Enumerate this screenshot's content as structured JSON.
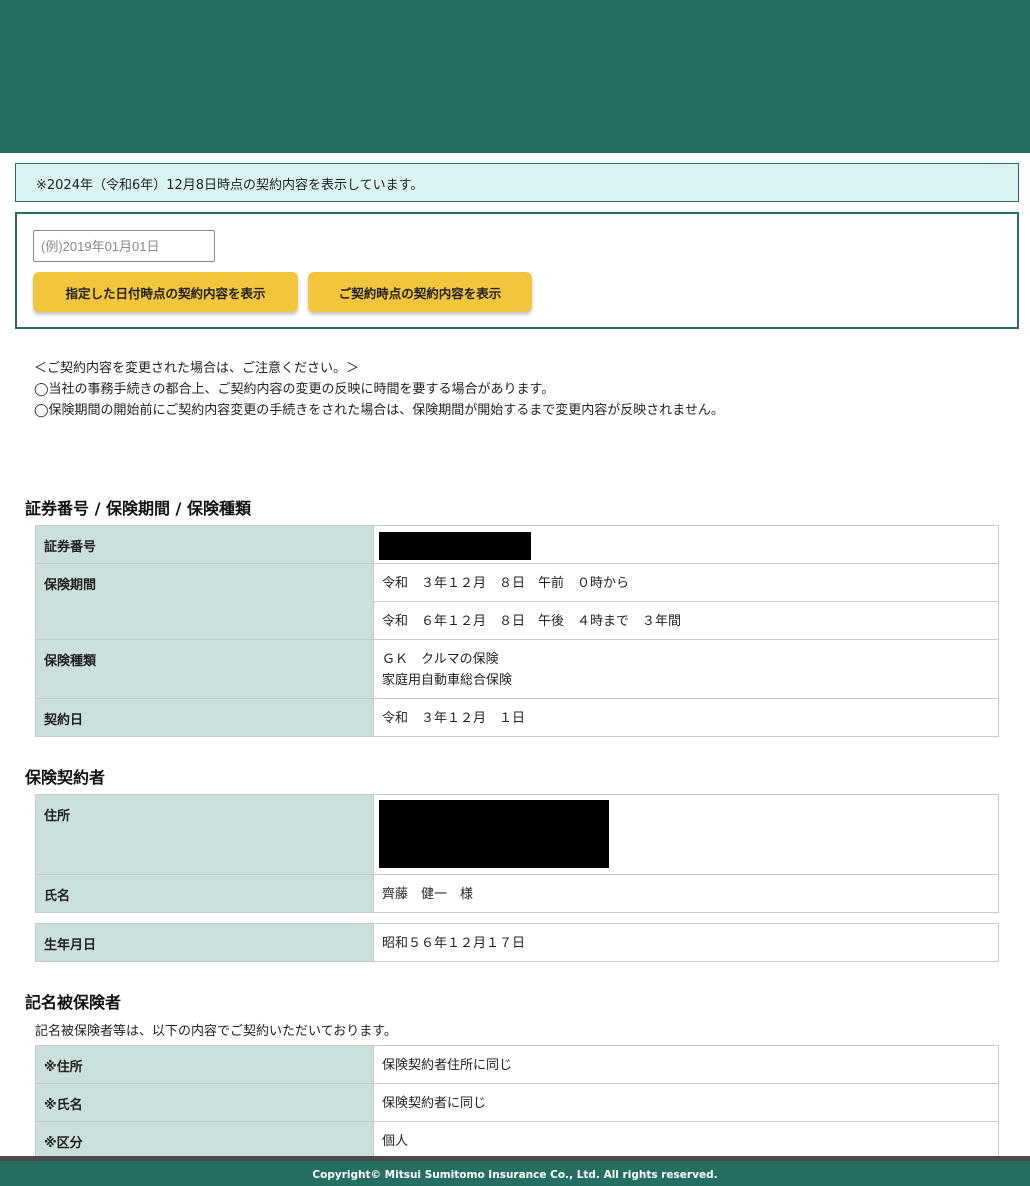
{
  "notice": {
    "text": "※2024年（令和6年）12月8日時点の契約内容を表示しています。"
  },
  "date_panel": {
    "input_placeholder": "(例)2019年01月01日",
    "btn_date_label": "指定した日付時点の契約内容を表示",
    "btn_contract_label": "ご契約時点の契約内容を表示"
  },
  "caution": {
    "heading": "＜ご契約内容を変更された場合は、ご注意ください。＞",
    "line1": "◯当社の事務手続きの都合上、ご契約内容の変更の反映に時間を要する場合があります。",
    "line2": "◯保険期間の開始前にご契約内容変更の手続きをされた場合は、保険期間が開始するまで変更内容が反映されません。"
  },
  "policy": {
    "title": "証券番号 / 保険期間 / 保険種類",
    "rows": [
      {
        "label": "証券番号"
      },
      {
        "label": "保険期間",
        "value1": "令和　３年１２月　８日　午前　０時から",
        "value2": "令和　６年１２月　８日　午後　４時まで　３年間"
      },
      {
        "label": "保険種類",
        "value1": "ＧＫ　クルマの保険",
        "value2": "家庭用自動車総合保険"
      },
      {
        "label": "契約日",
        "value": "令和　３年１２月　１日"
      }
    ]
  },
  "contractor": {
    "title": "保険契約者",
    "rows": [
      {
        "label": "住所"
      },
      {
        "label": "氏名",
        "value": "齊藤　健一　様"
      }
    ],
    "birth": {
      "label": "生年月日",
      "value": "昭和５６年１２月１７日"
    }
  },
  "insured": {
    "title": "記名被保険者",
    "note": "記名被保険者等は、以下の内容でご契約いただいております。",
    "rows": [
      {
        "label": "※住所",
        "value": "保険契約者住所に同じ"
      },
      {
        "label": "※氏名",
        "value": "保険契約者に同じ"
      },
      {
        "label": "※区分",
        "value": "個人"
      }
    ]
  },
  "footer": {
    "text": "Copyright© Mitsui Sumitomo Insurance Co., Ltd. All rights reserved."
  },
  "colors": {
    "brand": "#246e62",
    "notice_bg": "#d9f3f2",
    "label_bg": "#c9e0dd",
    "button": "#f2c53d"
  }
}
